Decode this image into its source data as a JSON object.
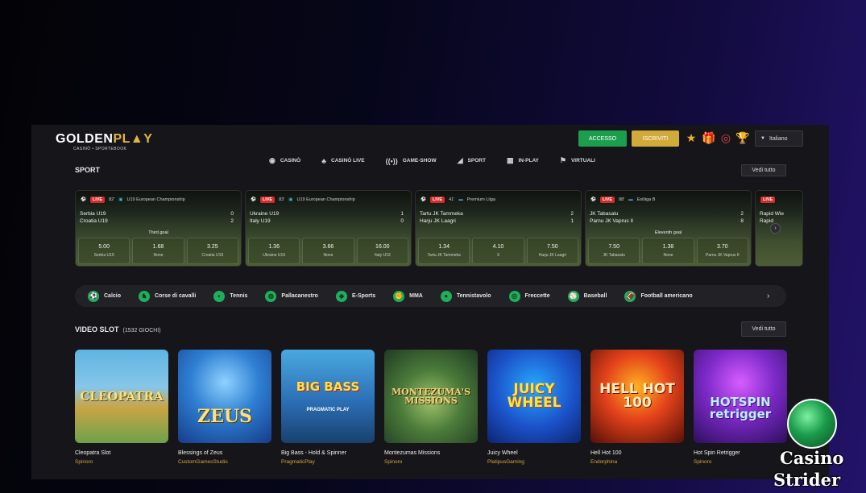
{
  "header": {
    "logo_main_a": "GOLDEN",
    "logo_main_b": "PL",
    "logo_main_c": "Y",
    "logo_sub": "CASINÒ • SPORTEBOOK",
    "login_label": "ACCESSO",
    "register_label": "ISCRIVITI",
    "language": "Italiano",
    "icons": [
      "star-icon",
      "gift-icon",
      "target-icon",
      "trophy-icon"
    ]
  },
  "nav": [
    {
      "label": "CASINÒ",
      "icon": "chip-icon"
    },
    {
      "label": "CASINÒ LIVE",
      "icon": "dealer-icon"
    },
    {
      "label": "GAME-SHOW",
      "icon": "broadcast-icon"
    },
    {
      "label": "SPORT",
      "icon": "sneaker-icon"
    },
    {
      "label": "IN-PLAY",
      "icon": "scoreboard-icon"
    },
    {
      "label": "VIRTUALI",
      "icon": "virtual-icon"
    }
  ],
  "sport": {
    "title": "SPORT",
    "see_all": "Vedi tutto",
    "matches": [
      {
        "live": "LIVE",
        "minute": "82'",
        "league": "U19 European Championship",
        "home": "Serbia U19",
        "away": "Croatia U19",
        "home_score": "0",
        "away_score": "2",
        "event": "Third goal",
        "odds": [
          {
            "v": "5.00",
            "l": "Serbia U19"
          },
          {
            "v": "1.68",
            "l": "None"
          },
          {
            "v": "3.25",
            "l": "Croatia U19"
          }
        ]
      },
      {
        "live": "LIVE",
        "minute": "83'",
        "league": "U19 European Championship",
        "home": "Ukraine U19",
        "away": "Italy U19",
        "home_score": "1",
        "away_score": "0",
        "event": "",
        "odds": [
          {
            "v": "1.36",
            "l": "Ukraine U19"
          },
          {
            "v": "3.66",
            "l": "None"
          },
          {
            "v": "16.00",
            "l": "Italy U19"
          }
        ]
      },
      {
        "live": "LIVE",
        "minute": "41'",
        "league": "Premium Liiga",
        "home": "Tartu JK Tammeka",
        "away": "Harju JK Laagri",
        "home_score": "2",
        "away_score": "1",
        "event": "",
        "odds": [
          {
            "v": "1.34",
            "l": "Tartu JK Tammeka"
          },
          {
            "v": "4.10",
            "l": "X"
          },
          {
            "v": "7.50",
            "l": "Harju JK Laagri"
          }
        ]
      },
      {
        "live": "LIVE",
        "minute": "88'",
        "league": "Esiliiga B",
        "home": "JK Tabasalu",
        "away": "Parnu JK Vaprus II",
        "home_score": "2",
        "away_score": "8",
        "event": "Eleventh goal",
        "odds": [
          {
            "v": "7.50",
            "l": "JK Tabasalu"
          },
          {
            "v": "1.38",
            "l": "None"
          },
          {
            "v": "3.70",
            "l": "Parnu JK Vaprus II"
          }
        ]
      },
      {
        "live": "LIVE",
        "minute": "",
        "league": "",
        "home": "Rapid Wie",
        "away": "Rapid",
        "home_score": "",
        "away_score": "",
        "event": "",
        "odds": [
          {
            "v": "",
            "l": ""
          }
        ]
      }
    ]
  },
  "categories": [
    {
      "label": "Calcio",
      "icon": "soccer-icon"
    },
    {
      "label": "Corse di cavalli",
      "icon": "horse-icon"
    },
    {
      "label": "Tennis",
      "icon": "tennis-icon"
    },
    {
      "label": "Pallacanestro",
      "icon": "basketball-icon"
    },
    {
      "label": "E-Sports",
      "icon": "esports-icon"
    },
    {
      "label": "MMA",
      "icon": "mma-icon"
    },
    {
      "label": "Tennistavolo",
      "icon": "pingpong-icon"
    },
    {
      "label": "Freccette",
      "icon": "darts-icon"
    },
    {
      "label": "Baseball",
      "icon": "baseball-icon"
    },
    {
      "label": "Football americano",
      "icon": "football-icon"
    }
  ],
  "slots": {
    "title": "VIDEO SLOT",
    "count": "(1532 GIOCHI)",
    "see_all": "Vedi tutto",
    "games": [
      {
        "name": "Cleopatra Slot",
        "provider": "Spinoro",
        "art": "CLEOPATRA"
      },
      {
        "name": "Blessings of Zeus",
        "provider": "CustomGamesStudio",
        "art": "ZEUS"
      },
      {
        "name": "Big Bass - Hold & Spinner",
        "provider": "PragmaticPlay",
        "art": "BIG BASS",
        "art_sub": "PRAGMATIC PLAY"
      },
      {
        "name": "Montezumas Missions",
        "provider": "Spinoro",
        "art": "MONTEZUMA'S MISSIONS"
      },
      {
        "name": "Juicy Wheel",
        "provider": "PlatipusGaming",
        "art": "JUICY WHEEL"
      },
      {
        "name": "Hell Hot 100",
        "provider": "Endorphina",
        "art": "HELL HOT 100"
      },
      {
        "name": "Hot Spin Retrigger",
        "provider": "Spinoro",
        "art": "HOTSPIN retrigger"
      }
    ]
  },
  "watermark": {
    "line1": "Casino",
    "line2": "Strider"
  }
}
